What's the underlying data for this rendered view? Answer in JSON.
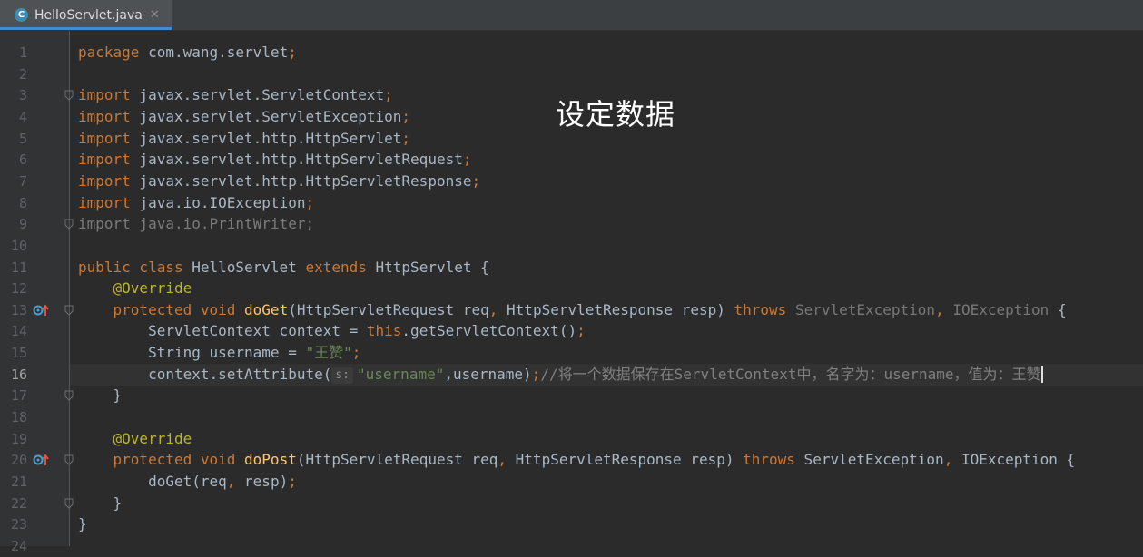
{
  "tab": {
    "icon_letter": "C",
    "filename": "HelloServlet.java",
    "close_glyph": "✕"
  },
  "overlay_caption": "设定数据",
  "current_line": 16,
  "lines": [
    {
      "n": "1",
      "code": [
        {
          "t": "package",
          "c": "kw"
        },
        {
          "t": " com.wang.servlet"
        },
        {
          "t": ";",
          "c": "kw"
        }
      ]
    },
    {
      "n": "2",
      "code": []
    },
    {
      "n": "3",
      "code": [
        {
          "t": "import",
          "c": "kw"
        },
        {
          "t": " javax.servlet.ServletContext"
        },
        {
          "t": ";",
          "c": "kw"
        }
      ]
    },
    {
      "n": "4",
      "code": [
        {
          "t": "import",
          "c": "kw"
        },
        {
          "t": " javax.servlet.ServletException"
        },
        {
          "t": ";",
          "c": "kw"
        }
      ]
    },
    {
      "n": "5",
      "code": [
        {
          "t": "import",
          "c": "kw"
        },
        {
          "t": " javax.servlet.http.HttpServlet"
        },
        {
          "t": ";",
          "c": "kw"
        }
      ]
    },
    {
      "n": "6",
      "code": [
        {
          "t": "import",
          "c": "kw"
        },
        {
          "t": " javax.servlet.http.HttpServletRequest"
        },
        {
          "t": ";",
          "c": "kw"
        }
      ]
    },
    {
      "n": "7",
      "code": [
        {
          "t": "import",
          "c": "kw"
        },
        {
          "t": " javax.servlet.http.HttpServletResponse"
        },
        {
          "t": ";",
          "c": "kw"
        }
      ]
    },
    {
      "n": "8",
      "code": [
        {
          "t": "import",
          "c": "kw"
        },
        {
          "t": " java.io.IOException"
        },
        {
          "t": ";",
          "c": "kw"
        }
      ]
    },
    {
      "n": "9",
      "code": [
        {
          "t": "import java.io.PrintWriter;",
          "c": "dim"
        }
      ]
    },
    {
      "n": "10",
      "code": []
    },
    {
      "n": "11",
      "code": [
        {
          "t": "public class",
          "c": "kw"
        },
        {
          "t": " HelloServlet "
        },
        {
          "t": "extends",
          "c": "kw"
        },
        {
          "t": " HttpServlet {"
        }
      ]
    },
    {
      "n": "12",
      "code": [
        {
          "t": "    "
        },
        {
          "t": "@Override",
          "c": "ann"
        }
      ]
    },
    {
      "n": "13",
      "code": [
        {
          "t": "    "
        },
        {
          "t": "protected void",
          "c": "kw"
        },
        {
          "t": " "
        },
        {
          "t": "doGet",
          "c": "fn"
        },
        {
          "t": "(HttpServletRequest req"
        },
        {
          "t": ",",
          "c": "kw"
        },
        {
          "t": " HttpServletResponse resp) "
        },
        {
          "t": "throws",
          "c": "kw"
        },
        {
          "t": " "
        },
        {
          "t": "ServletException",
          "c": "param"
        },
        {
          "t": ",",
          "c": "kw"
        },
        {
          "t": " "
        },
        {
          "t": "IOException",
          "c": "param"
        },
        {
          "t": " {"
        }
      ]
    },
    {
      "n": "14",
      "code": [
        {
          "t": "        ServletContext context = "
        },
        {
          "t": "this",
          "c": "kw"
        },
        {
          "t": ".getServletContext()"
        },
        {
          "t": ";",
          "c": "kw"
        }
      ]
    },
    {
      "n": "15",
      "code": [
        {
          "t": "        String username = "
        },
        {
          "t": "\"王赞\"",
          "c": "str"
        },
        {
          "t": ";",
          "c": "kw"
        }
      ]
    },
    {
      "n": "16",
      "code": [
        {
          "t": "        context.setAttribute("
        },
        {
          "t": "s:",
          "c": "hint"
        },
        {
          "t": "\"username\"",
          "c": "str"
        },
        {
          "t": ",username)"
        },
        {
          "t": ";",
          "c": "kw"
        },
        {
          "t": "//将一个数据保存在ServletContext中，名字为：username，值为：王赞",
          "c": "cmt"
        },
        {
          "t": "",
          "c": "caret"
        }
      ]
    },
    {
      "n": "17",
      "code": [
        {
          "t": "    }"
        }
      ]
    },
    {
      "n": "18",
      "code": []
    },
    {
      "n": "19",
      "code": [
        {
          "t": "    "
        },
        {
          "t": "@Override",
          "c": "ann"
        }
      ]
    },
    {
      "n": "20",
      "code": [
        {
          "t": "    "
        },
        {
          "t": "protected void",
          "c": "kw"
        },
        {
          "t": " "
        },
        {
          "t": "doPost",
          "c": "fn"
        },
        {
          "t": "(HttpServletRequest req"
        },
        {
          "t": ",",
          "c": "kw"
        },
        {
          "t": " HttpServletResponse resp) "
        },
        {
          "t": "throws",
          "c": "kw"
        },
        {
          "t": " ServletException"
        },
        {
          "t": ",",
          "c": "kw"
        },
        {
          "t": " IOException {"
        }
      ]
    },
    {
      "n": "21",
      "code": [
        {
          "t": "        doGet(req"
        },
        {
          "t": ",",
          "c": "kw"
        },
        {
          "t": " resp)"
        },
        {
          "t": ";",
          "c": "kw"
        }
      ]
    },
    {
      "n": "22",
      "code": [
        {
          "t": "    }"
        }
      ]
    },
    {
      "n": "23",
      "code": [
        {
          "t": "}"
        }
      ]
    },
    {
      "n": "24",
      "code": []
    }
  ],
  "gutter_markers": [
    {
      "line": "13",
      "icons": [
        "override-method-icon",
        "implements-up-arrow-icon"
      ]
    },
    {
      "line": "20",
      "icons": [
        "override-method-icon",
        "implements-up-arrow-icon"
      ]
    }
  ],
  "fold_markers": [
    "3",
    "9",
    "13",
    "17",
    "20",
    "22"
  ],
  "colors": {
    "background": "#2b2b2b",
    "gutter": "#313335",
    "keyword": "#cc7832",
    "annotation": "#bbb529",
    "method": "#ffc66d",
    "string": "#6a8759",
    "comment": "#808080",
    "text": "#a9b7c6",
    "tab_accent": "#4a88c7"
  }
}
